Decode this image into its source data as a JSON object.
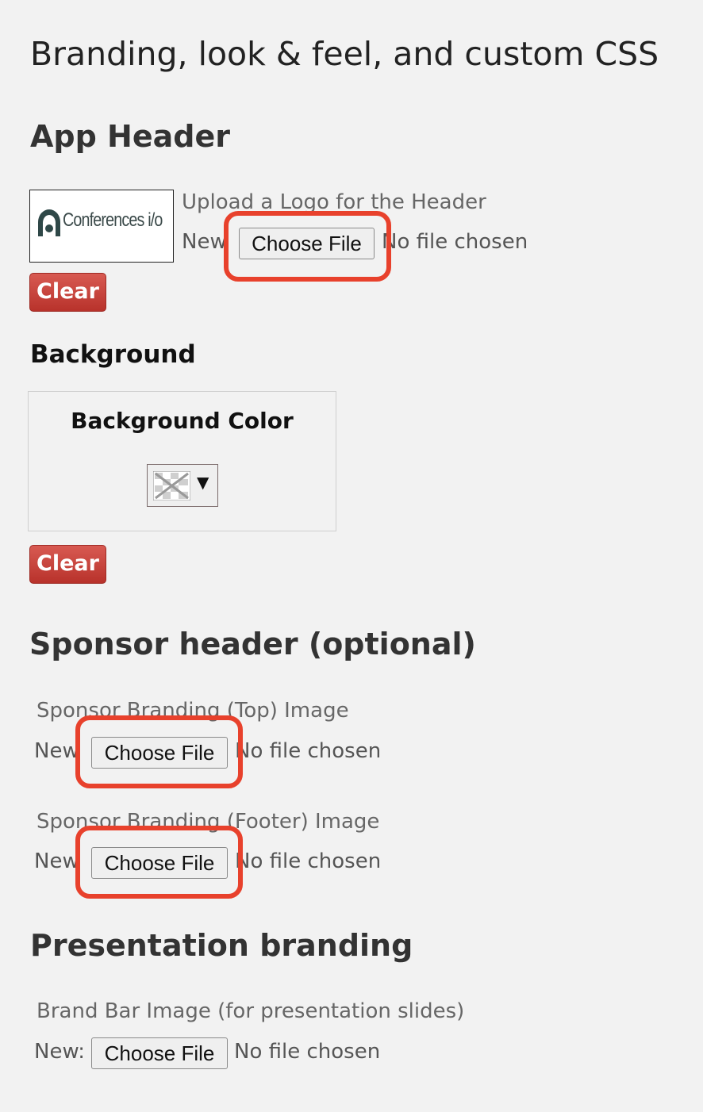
{
  "page": {
    "title": "Branding, look & feel, and custom CSS"
  },
  "app_header": {
    "title": "App Header",
    "logo_text": "Conferences i/o",
    "upload_label": "Upload a Logo for the Header",
    "new_label": "New",
    "choose_file": "Choose File",
    "no_file": "No file chosen",
    "clear": "Clear"
  },
  "background": {
    "title": "Background",
    "color_label": "Background Color",
    "caret": "▼",
    "clear": "Clear"
  },
  "sponsor_header": {
    "title": "Sponsor header (optional)",
    "top": {
      "label": "Sponsor Branding (Top) Image",
      "new_label": "New",
      "choose_file": "Choose File",
      "no_file": "No file chosen"
    },
    "footer": {
      "label": "Sponsor Branding (Footer) Image",
      "new_label": "New",
      "choose_file": "Choose File",
      "no_file": "No file chosen"
    }
  },
  "presentation_branding": {
    "title": "Presentation branding",
    "brand_bar_label": "Brand Bar Image (for presentation slides)",
    "new_label": "New:",
    "choose_file": "Choose File",
    "no_file": "No file chosen"
  },
  "colors": {
    "highlight": "#e8412c",
    "clear_button": "#c0392b",
    "background": "#f2f2f2"
  }
}
